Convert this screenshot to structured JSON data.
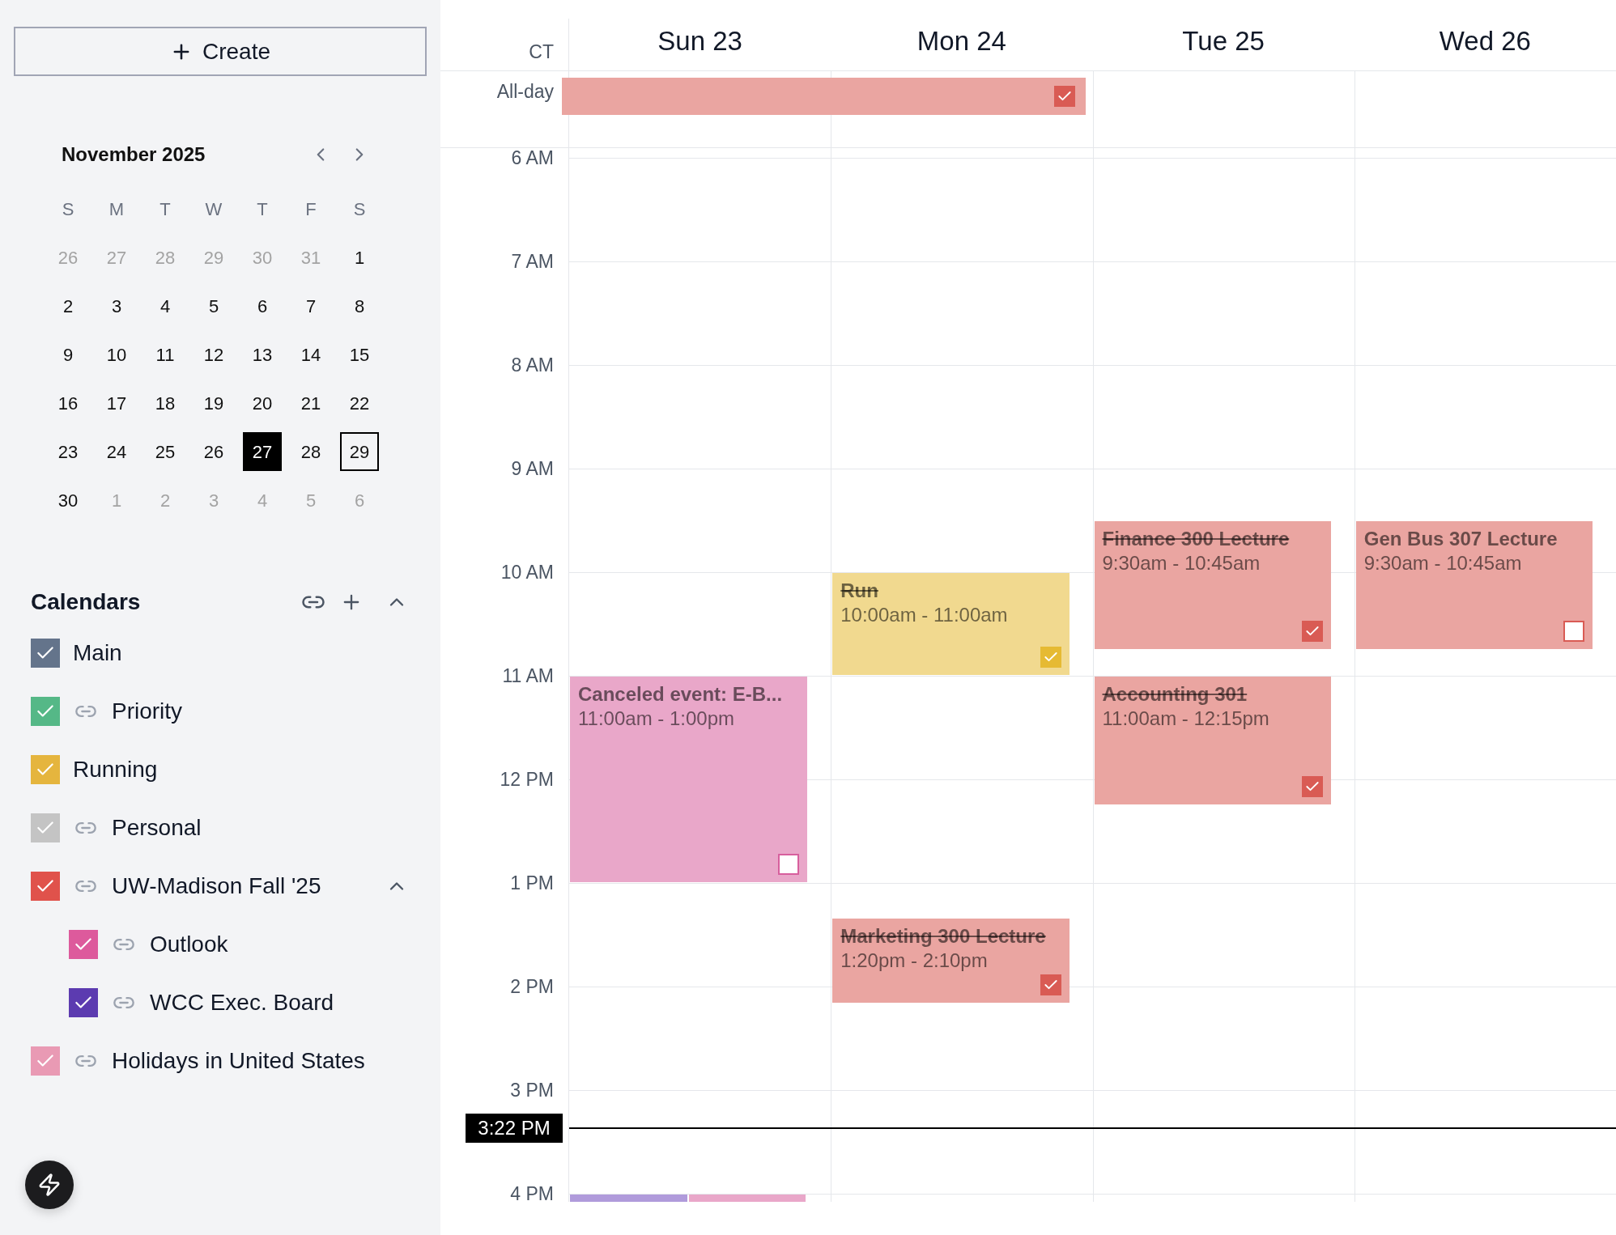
{
  "sidebar": {
    "create_button": {
      "label": "Create"
    },
    "mini_calendar": {
      "title": "November 2025",
      "weekdays": [
        "S",
        "M",
        "T",
        "W",
        "T",
        "F",
        "S"
      ],
      "days": [
        {
          "label": "26",
          "outside": true,
          "today": false,
          "selected": false
        },
        {
          "label": "27",
          "outside": true,
          "today": false,
          "selected": false
        },
        {
          "label": "28",
          "outside": true,
          "today": false,
          "selected": false
        },
        {
          "label": "29",
          "outside": true,
          "today": false,
          "selected": false
        },
        {
          "label": "30",
          "outside": true,
          "today": false,
          "selected": false
        },
        {
          "label": "31",
          "outside": true,
          "today": false,
          "selected": false
        },
        {
          "label": "1",
          "outside": false,
          "today": false,
          "selected": false
        },
        {
          "label": "2",
          "outside": false,
          "today": false,
          "selected": false
        },
        {
          "label": "3",
          "outside": false,
          "today": false,
          "selected": false
        },
        {
          "label": "4",
          "outside": false,
          "today": false,
          "selected": false
        },
        {
          "label": "5",
          "outside": false,
          "today": false,
          "selected": false
        },
        {
          "label": "6",
          "outside": false,
          "today": false,
          "selected": false
        },
        {
          "label": "7",
          "outside": false,
          "today": false,
          "selected": false
        },
        {
          "label": "8",
          "outside": false,
          "today": false,
          "selected": false
        },
        {
          "label": "9",
          "outside": false,
          "today": false,
          "selected": false
        },
        {
          "label": "10",
          "outside": false,
          "today": false,
          "selected": false
        },
        {
          "label": "11",
          "outside": false,
          "today": false,
          "selected": false
        },
        {
          "label": "12",
          "outside": false,
          "today": false,
          "selected": false
        },
        {
          "label": "13",
          "outside": false,
          "today": false,
          "selected": false
        },
        {
          "label": "14",
          "outside": false,
          "today": false,
          "selected": false
        },
        {
          "label": "15",
          "outside": false,
          "today": false,
          "selected": false
        },
        {
          "label": "16",
          "outside": false,
          "today": false,
          "selected": false
        },
        {
          "label": "17",
          "outside": false,
          "today": false,
          "selected": false
        },
        {
          "label": "18",
          "outside": false,
          "today": false,
          "selected": false
        },
        {
          "label": "19",
          "outside": false,
          "today": false,
          "selected": false
        },
        {
          "label": "20",
          "outside": false,
          "today": false,
          "selected": false
        },
        {
          "label": "21",
          "outside": false,
          "today": false,
          "selected": false
        },
        {
          "label": "22",
          "outside": false,
          "today": false,
          "selected": false
        },
        {
          "label": "23",
          "outside": false,
          "today": false,
          "selected": false
        },
        {
          "label": "24",
          "outside": false,
          "today": false,
          "selected": false
        },
        {
          "label": "25",
          "outside": false,
          "today": false,
          "selected": false
        },
        {
          "label": "26",
          "outside": false,
          "today": false,
          "selected": false
        },
        {
          "label": "27",
          "outside": false,
          "today": true,
          "selected": false
        },
        {
          "label": "28",
          "outside": false,
          "today": false,
          "selected": false
        },
        {
          "label": "29",
          "outside": false,
          "today": false,
          "selected": true
        },
        {
          "label": "30",
          "outside": false,
          "today": false,
          "selected": false
        },
        {
          "label": "1",
          "outside": true,
          "today": false,
          "selected": false
        },
        {
          "label": "2",
          "outside": true,
          "today": false,
          "selected": false
        },
        {
          "label": "3",
          "outside": true,
          "today": false,
          "selected": false
        },
        {
          "label": "4",
          "outside": true,
          "today": false,
          "selected": false
        },
        {
          "label": "5",
          "outside": true,
          "today": false,
          "selected": false
        },
        {
          "label": "6",
          "outside": true,
          "today": false,
          "selected": false
        }
      ]
    },
    "calendars": {
      "title": "Calendars",
      "expanded": true,
      "items": [
        {
          "name": "Main",
          "color": "#64748b",
          "checked": true,
          "linked": false
        },
        {
          "name": "Priority",
          "color": "#55b887",
          "checked": true,
          "linked": true
        },
        {
          "name": "Running",
          "color": "#e5b53e",
          "checked": true,
          "linked": false
        },
        {
          "name": "Personal",
          "color": "#c4c4c4",
          "checked": true,
          "linked": true
        },
        {
          "name": "UW-Madison Fall '25",
          "color": "#e0524b",
          "checked": true,
          "linked": true,
          "expanded": true,
          "children": [
            {
              "name": "Outlook",
              "color": "#dd5a9c",
              "checked": true,
              "linked": true
            },
            {
              "name": "WCC Exec. Board",
              "color": "#5c3bb0",
              "checked": true,
              "linked": true
            }
          ]
        },
        {
          "name": "Holidays in United States",
          "color": "#e99ab4",
          "checked": true,
          "linked": true
        }
      ]
    }
  },
  "week": {
    "timezone": "CT",
    "all_day_label": "All-day",
    "all_day_events": [
      {
        "color": "#eaa5a1",
        "done": true
      }
    ],
    "days": [
      {
        "label": "Sun 23",
        "events": [
          {
            "title": "Canceled event: E-B...",
            "time": "11:00am - 1:00pm",
            "color": "#e9a7c9",
            "done": false
          },
          {
            "color": "#b09bdb"
          },
          {
            "color": "#e9a7c9"
          }
        ]
      },
      {
        "label": "Mon 24",
        "events": [
          {
            "title": "Run",
            "time": "10:00am - 11:00am",
            "color": "#f1d98f",
            "done": true
          },
          {
            "title": "Marketing 300 Lecture",
            "time": "1:20pm - 2:10pm",
            "color": "#eaa5a1",
            "done": true
          }
        ]
      },
      {
        "label": "Tue 25",
        "events": [
          {
            "title": "Finance 300 Lecture",
            "time": "9:30am - 10:45am",
            "color": "#eaa5a1",
            "done": true
          },
          {
            "title": "Accounting 301",
            "time": "11:00am - 12:15pm",
            "color": "#eaa5a1",
            "done": true
          }
        ]
      },
      {
        "label": "Wed 26",
        "events": [
          {
            "title": "Gen Bus 307 Lecture",
            "time": "9:30am - 10:45am",
            "color": "#eaa5a1",
            "done": false
          }
        ]
      }
    ],
    "hours": [
      "6 AM",
      "7 AM",
      "8 AM",
      "9 AM",
      "10 AM",
      "11 AM",
      "12 PM",
      "1 PM",
      "2 PM",
      "3 PM",
      "4 PM"
    ],
    "now": {
      "label": "3:22 PM"
    }
  }
}
